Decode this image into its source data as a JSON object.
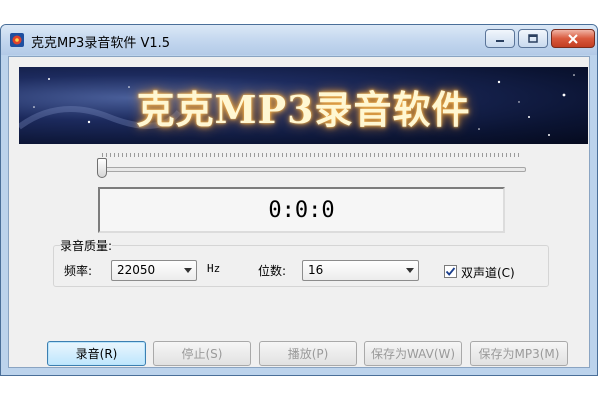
{
  "window": {
    "title": "克克MP3录音软件 V1.5"
  },
  "banner": {
    "title": "克克MP3录音软件"
  },
  "time_display": "0:0:0",
  "progress": 0,
  "recording_quality": {
    "label": "录音质量:",
    "frequency_label": "频率:",
    "frequency_value": "22050",
    "frequency_unit": "Hz",
    "bits_label": "位数:",
    "bits_value": "16",
    "stereo_label": "双声道(C)",
    "stereo_checked": true
  },
  "buttons": {
    "record": "录音(R)",
    "stop": "停止(S)",
    "play": "播放(P)",
    "save_wav": "保存为WAV(W)",
    "save_mp3": "保存为MP3(M)"
  },
  "icons": [
    "app-icon",
    "minimize-icon",
    "maximize-icon",
    "close-icon",
    "dropdown-arrow-icon",
    "checkmark-icon"
  ],
  "colors": {
    "titlebar": "#c2d6ee",
    "close_button": "#d9593d",
    "banner_text_glow": "#f4b04a"
  }
}
